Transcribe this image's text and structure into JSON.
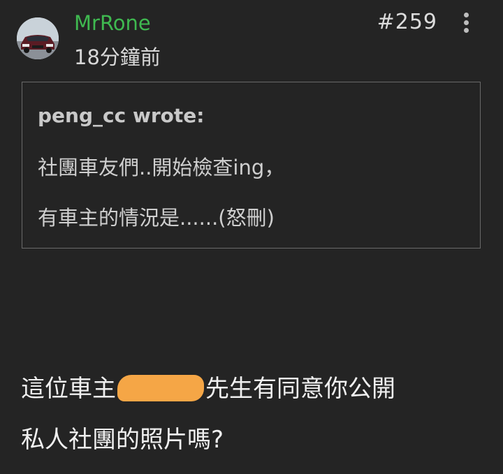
{
  "post": {
    "username": "MrRone",
    "timestamp": "18分鐘前",
    "post_number": "#259"
  },
  "quote": {
    "author": "peng_cc wrote:",
    "line1": "社團車友們..開始檢查ing，",
    "line2": "有車主的情況是......(怒刪)"
  },
  "reply": {
    "line1_before": "這位車主",
    "line1_after": "先生有同意你公開",
    "line2": "私人社團的照片嗎?"
  },
  "icons": {
    "more": "more-vertical-icon",
    "avatar": "car-avatar-image"
  },
  "colors": {
    "background": "#242424",
    "username": "#3fb950",
    "redaction": "#f5a646"
  }
}
